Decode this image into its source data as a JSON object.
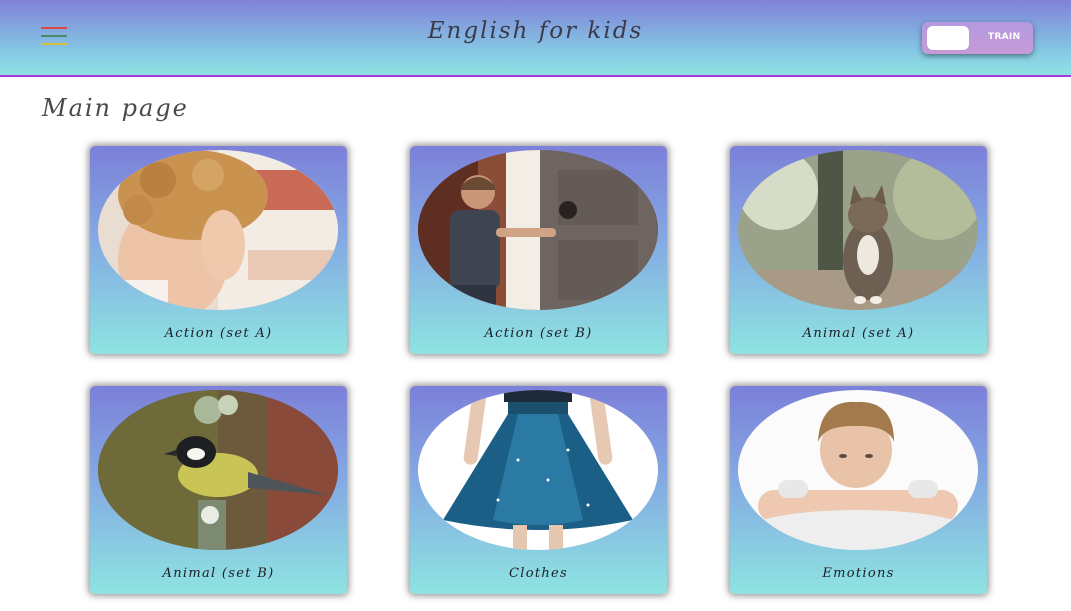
{
  "header": {
    "title": "English for kids",
    "menu_icon": "hamburger-menu-icon",
    "mode_toggle": {
      "label": "TRAIN"
    }
  },
  "main": {
    "page_title": "Main page",
    "categories": [
      {
        "label": "Action (set A)",
        "image": "child-covering-face"
      },
      {
        "label": "Action (set B)",
        "image": "boy-opening-door"
      },
      {
        "label": "Animal (set A)",
        "image": "cat-sitting"
      },
      {
        "label": "Animal (set B)",
        "image": "bird-on-branch"
      },
      {
        "label": "Clothes",
        "image": "blue-skirt"
      },
      {
        "label": "Emotions",
        "image": "sad-boy"
      }
    ]
  },
  "colors": {
    "header_gradient_top": "#7f82d8",
    "header_gradient_bottom": "#8fe3e2",
    "header_border": "#a13ad9",
    "card_gradient_top": "#7c80d9",
    "card_gradient_bottom": "#8ee4e2",
    "toggle_bg": "#b49ae0"
  }
}
